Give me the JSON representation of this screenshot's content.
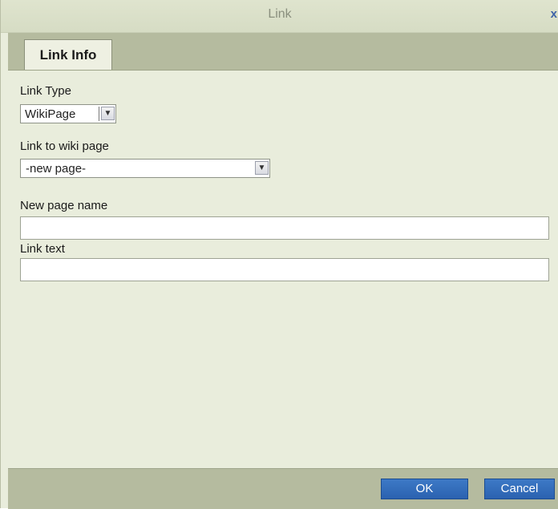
{
  "dialog": {
    "title": "Link",
    "close_glyph": "x",
    "tabs": [
      {
        "label": "Link Info"
      }
    ]
  },
  "form": {
    "link_type": {
      "label": "Link Type",
      "value": "WikiPage"
    },
    "link_to_page": {
      "label": "Link to wiki page",
      "value": "-new page-"
    },
    "new_page_name": {
      "label": "New page name",
      "value": ""
    },
    "link_text": {
      "label": "Link text",
      "value": ""
    }
  },
  "buttons": {
    "ok": "OK",
    "cancel": "Cancel"
  },
  "colors": {
    "dialog_background": "#e9eddc",
    "tabstrip": "#b5bb9f",
    "button_blue": "#2f6bb8",
    "close_icon": "#3e63a8"
  },
  "icons": {
    "close": "close-icon",
    "dropdown": "chevron-down-icon"
  }
}
